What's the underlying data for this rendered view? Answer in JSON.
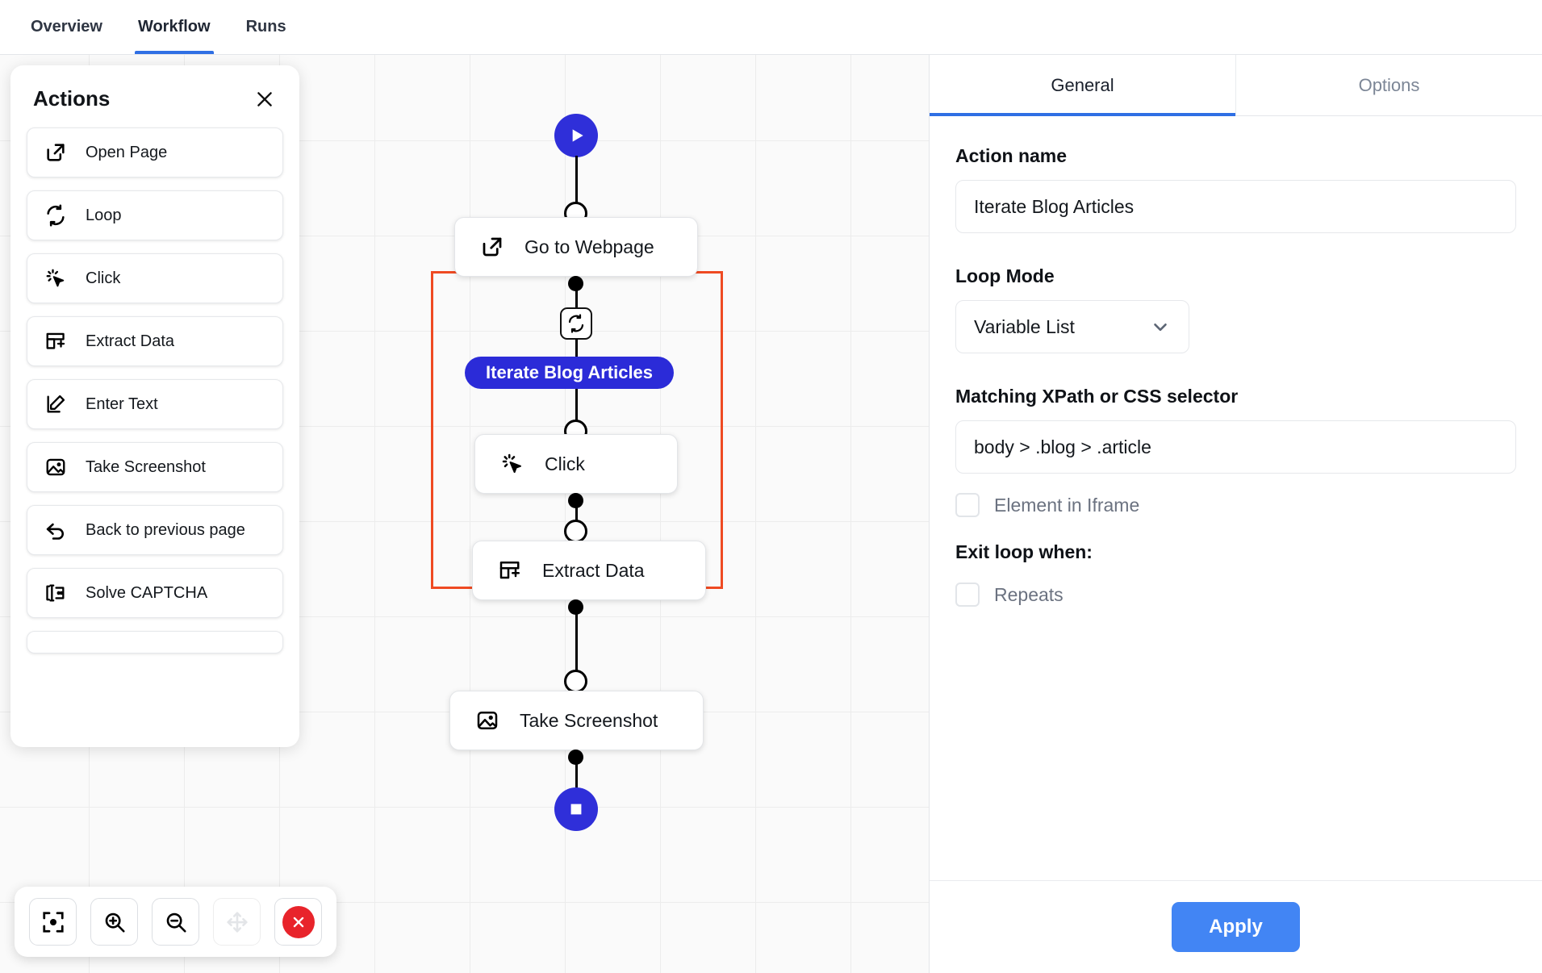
{
  "top_tabs": [
    {
      "label": "Overview",
      "active": false
    },
    {
      "label": "Workflow",
      "active": true
    },
    {
      "label": "Runs",
      "active": false
    }
  ],
  "actions_panel": {
    "title": "Actions",
    "close_icon": "close-icon",
    "items": [
      {
        "label": "Open Page",
        "icon": "external-link-icon"
      },
      {
        "label": "Loop",
        "icon": "loop-icon"
      },
      {
        "label": "Click",
        "icon": "cursor-click-icon"
      },
      {
        "label": "Extract Data",
        "icon": "table-add-icon"
      },
      {
        "label": "Enter Text",
        "icon": "pencil-edit-icon"
      },
      {
        "label": "Take Screenshot",
        "icon": "image-icon"
      },
      {
        "label": "Back to previous page",
        "icon": "arrow-back-icon"
      },
      {
        "label": "Solve CAPTCHA",
        "icon": "captcha-icon"
      }
    ]
  },
  "canvas": {
    "start_node": {
      "icon": "play-icon",
      "name": "start"
    },
    "end_node": {
      "icon": "stop-square-icon",
      "name": "end"
    },
    "nodes": [
      {
        "label": "Go to Webpage",
        "icon": "external-link-icon"
      },
      {
        "label": "Click",
        "icon": "cursor-click-icon"
      },
      {
        "label": "Extract Data",
        "icon": "table-add-icon"
      },
      {
        "label": "Take Screenshot",
        "icon": "image-icon"
      }
    ],
    "loop_badge": {
      "label": "Iterate Blog Articles",
      "icon": "loop-icon",
      "color": "#2b2bd8"
    },
    "selection_color": "#ef4a22",
    "toolbar": [
      {
        "name": "fit-to-view-button",
        "icon": "focus-target-icon",
        "disabled": false
      },
      {
        "name": "zoom-in-button",
        "icon": "zoom-in-icon",
        "disabled": false
      },
      {
        "name": "zoom-out-button",
        "icon": "zoom-out-icon",
        "disabled": false
      },
      {
        "name": "pan-button",
        "icon": "move-arrows-icon",
        "disabled": true
      },
      {
        "name": "delete-button",
        "icon": "close-circle-icon",
        "disabled": false
      }
    ]
  },
  "right_panel": {
    "tabs": [
      {
        "label": "General",
        "active": true
      },
      {
        "label": "Options",
        "active": false
      }
    ],
    "action_name_label": "Action name",
    "action_name_value": "Iterate Blog Articles",
    "loop_mode_label": "Loop Mode",
    "loop_mode_value": "Variable List",
    "selector_label": "Matching XPath or CSS selector",
    "selector_value": "body > .blog > .article",
    "iframe_checkbox_label": "Element in Iframe",
    "iframe_checked": false,
    "exit_loop_label": "Exit loop when:",
    "repeats_checkbox_label": "Repeats",
    "repeats_checked": false,
    "apply_label": "Apply",
    "accent_color": "#4285f4"
  }
}
